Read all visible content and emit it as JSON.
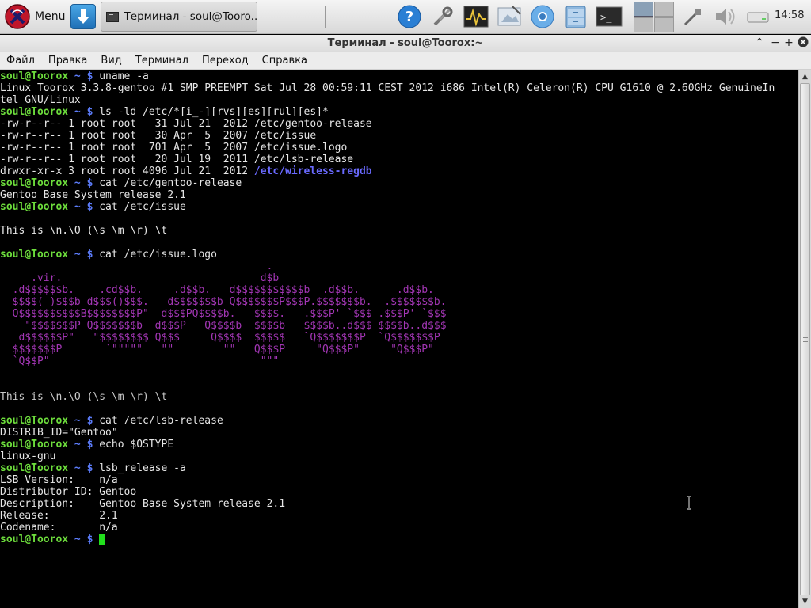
{
  "panel": {
    "menu_label": "Menu",
    "task_label": "Терминал - soul@Tooro...",
    "clock": "14:58"
  },
  "window": {
    "title": "Терминал - soul@Toorox:~"
  },
  "menubar": [
    "Файл",
    "Правка",
    "Вид",
    "Терминал",
    "Переход",
    "Справка"
  ],
  "terminal": {
    "prompt_user": "soul@Toorox",
    "prompt_dir": "~ $",
    "lines": [
      {
        "t": "cmd",
        "text": "uname -a"
      },
      {
        "t": "out",
        "text": "Linux Toorox 3.3.8-gentoo #1 SMP PREEMPT Sat Jul 28 00:59:11 CEST 2012 i686 Intel(R) Celeron(R) CPU G1610 @ 2.60GHz GenuineIn"
      },
      {
        "t": "out",
        "text": "tel GNU/Linux"
      },
      {
        "t": "cmd",
        "text": "ls -ld /etc/*[i_-][rvs][es][rul][es]*"
      },
      {
        "t": "out",
        "text": "-rw-r--r-- 1 root root   31 Jul 21  2012 /etc/gentoo-release"
      },
      {
        "t": "out",
        "text": "-rw-r--r-- 1 root root   30 Apr  5  2007 /etc/issue"
      },
      {
        "t": "out",
        "text": "-rw-r--r-- 1 root root  701 Apr  5  2007 /etc/issue.logo"
      },
      {
        "t": "out",
        "text": "-rw-r--r-- 1 root root   20 Jul 19  2011 /etc/lsb-release"
      },
      {
        "t": "dir",
        "text": "drwxr-xr-x 3 root root 4096 Jul 21  2012 ",
        "link": "/etc/wireless-regdb"
      },
      {
        "t": "cmd",
        "text": "cat /etc/gentoo-release"
      },
      {
        "t": "out",
        "text": "Gentoo Base System release 2.1"
      },
      {
        "t": "cmd",
        "text": "cat /etc/issue"
      },
      {
        "t": "out",
        "text": ""
      },
      {
        "t": "out",
        "text": "This is \\n.\\O (\\s \\m \\r) \\t"
      },
      {
        "t": "out",
        "text": ""
      },
      {
        "t": "cmd",
        "text": "cat /etc/issue.logo"
      },
      {
        "t": "logo",
        "text": "                                           ."
      },
      {
        "t": "logo",
        "text": "     .vir.                                d$b"
      },
      {
        "t": "logo",
        "text": "  .d$$$$$$b.    .cd$$b.     .d$$b.   d$$$$$$$$$$$b  .d$$b.      .d$$b."
      },
      {
        "t": "logo",
        "text": "  $$$$( )$$$b d$$$()$$$.   d$$$$$$$b Q$$$$$$$P$$$P.$$$$$$$b.  .$$$$$$$b."
      },
      {
        "t": "logo",
        "text": "  Q$$$$$$$$$$B$$$$$$$$P\"  d$$$PQ$$$$b.   $$$$.   .$$$P' `$$$ .$$$P' `$$$"
      },
      {
        "t": "logo",
        "text": "    \"$$$$$$$P Q$$$$$$$b  d$$$P   Q$$$$b  $$$$b   $$$$b..d$$$ $$$$b..d$$$"
      },
      {
        "t": "logo",
        "text": "   d$$$$$$P\"   \"$$$$$$$$ Q$$$     Q$$$$  $$$$$   `Q$$$$$$$P  `Q$$$$$$$P"
      },
      {
        "t": "logo",
        "text": "  $$$$$$$P       `\"\"\"\"\"   \"\"        \"\"   Q$$$P     \"Q$$$P\"     \"Q$$$P\""
      },
      {
        "t": "logo",
        "text": "  `Q$$P\"                                  \"\"\""
      },
      {
        "t": "out",
        "text": ""
      },
      {
        "t": "out",
        "text": ""
      },
      {
        "t": "dim",
        "text": "This is \\n.\\O (\\s \\m \\r) \\t"
      },
      {
        "t": "out",
        "text": ""
      },
      {
        "t": "cmd",
        "text": "cat /etc/lsb-release"
      },
      {
        "t": "out",
        "text": "DISTRIB_ID=\"Gentoo\""
      },
      {
        "t": "cmd",
        "text": "echo $OSTYPE"
      },
      {
        "t": "out",
        "text": "linux-gnu"
      },
      {
        "t": "cmd",
        "text": "lsb_release -a"
      },
      {
        "t": "out",
        "text": "LSB Version:    n/a"
      },
      {
        "t": "out",
        "text": "Distributor ID: Gentoo"
      },
      {
        "t": "out",
        "text": "Description:    Gentoo Base System release 2.1"
      },
      {
        "t": "out",
        "text": "Release:        2.1"
      },
      {
        "t": "out",
        "text": "Codename:       n/a"
      },
      {
        "t": "cur",
        "text": ""
      }
    ]
  },
  "colors": {
    "prompt_user": "#6ddd3c",
    "prompt_dir": "#5c7cfa",
    "logo": "#a236b4",
    "cursor": "#22e01d"
  },
  "icons": [
    "menu-logo-icon",
    "download-icon",
    "terminal-task-icon",
    "help-icon",
    "settings-tools-icon",
    "system-monitor-icon",
    "screenshot-icon",
    "chromium-icon",
    "file-manager-icon",
    "terminal-launcher-icon",
    "workspace-pager",
    "network-icon",
    "volume-icon",
    "drive-icon"
  ]
}
